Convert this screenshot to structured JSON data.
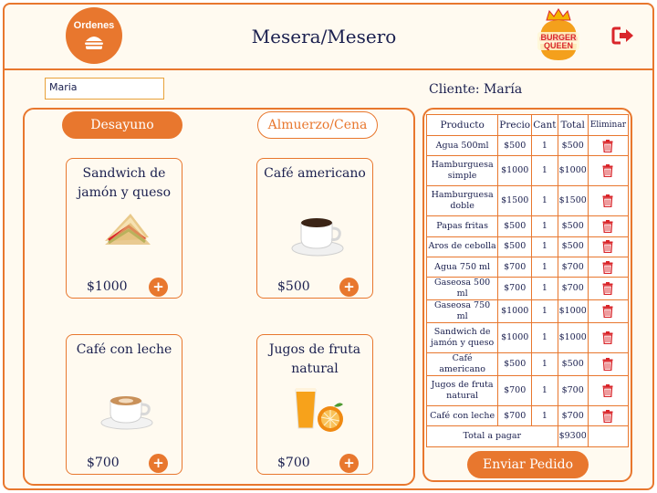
{
  "header": {
    "orders_label": "Ordenes",
    "title": "Mesera/Mesero",
    "logo_text_1": "BURGER",
    "logo_text_2": "QUEEN"
  },
  "client": {
    "input_value": "Maria",
    "label": "Cliente: María"
  },
  "tabs": {
    "breakfast": "Desayuno",
    "lunch": "Almuerzo/Cena"
  },
  "menu": [
    {
      "name": "Sandwich de jamón y queso",
      "price": "$1000",
      "icon": "sandwich-icon"
    },
    {
      "name": "Café americano",
      "price": "$500",
      "icon": "coffee-cup-icon"
    },
    {
      "name": "Café con leche",
      "price": "$700",
      "icon": "latte-icon"
    },
    {
      "name": "Jugos de fruta natural",
      "price": "$700",
      "icon": "orange-juice-icon"
    }
  ],
  "order": {
    "headers": [
      "Producto",
      "Precio",
      "Cant",
      "Total",
      "Eliminar"
    ],
    "rows": [
      {
        "product": "Agua 500ml",
        "price": "$500",
        "qty": "1",
        "total": "$500"
      },
      {
        "product": "Hamburguesa simple",
        "price": "$1000",
        "qty": "1",
        "total": "$1000"
      },
      {
        "product": "Hamburguesa doble",
        "price": "$1500",
        "qty": "1",
        "total": "$1500"
      },
      {
        "product": "Papas fritas",
        "price": "$500",
        "qty": "1",
        "total": "$500"
      },
      {
        "product": "Aros de cebolla",
        "price": "$500",
        "qty": "1",
        "total": "$500"
      },
      {
        "product": "Agua 750 ml",
        "price": "$700",
        "qty": "1",
        "total": "$700"
      },
      {
        "product": "Gaseosa 500 ml",
        "price": "$700",
        "qty": "1",
        "total": "$700"
      },
      {
        "product": "Gaseosa 750 ml",
        "price": "$1000",
        "qty": "1",
        "total": "$1000"
      },
      {
        "product": "Sandwich de jamón y queso",
        "price": "$1000",
        "qty": "1",
        "total": "$1000"
      },
      {
        "product": "Café americano",
        "price": "$500",
        "qty": "1",
        "total": "$500"
      },
      {
        "product": "Jugos de fruta natural",
        "price": "$700",
        "qty": "1",
        "total": "$700"
      },
      {
        "product": "Café con leche",
        "price": "$700",
        "qty": "1",
        "total": "$700"
      }
    ],
    "total_label": "Total a pagar",
    "total_value": "$9300",
    "send_label": "Enviar Pedido"
  },
  "colors": {
    "accent": "#e8772e",
    "text": "#1a1f4e",
    "delete": "#d9262b"
  }
}
